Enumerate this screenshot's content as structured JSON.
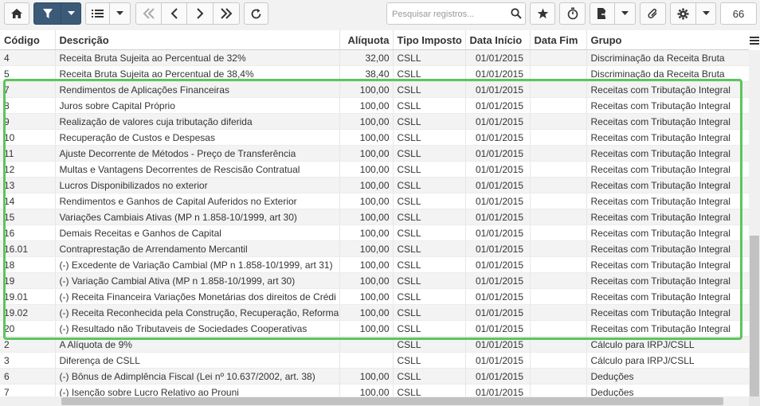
{
  "toolbar": {
    "search_placeholder": "Pesquisar registros...",
    "record_count": "66"
  },
  "colors": {
    "filter_button": "#3a5a78",
    "highlight": "#5cc55c"
  },
  "icons": [
    "home-icon",
    "filter-icon",
    "chevron-down-icon",
    "list-icon",
    "first-page-icon",
    "prev-page-icon",
    "next-page-icon",
    "last-page-icon",
    "refresh-icon",
    "search-icon",
    "star-icon",
    "stopwatch-icon",
    "export-icon",
    "paperclip-icon",
    "gear-icon",
    "menu-icon"
  ],
  "table": {
    "headers": {
      "codigo": "Código",
      "descricao": "Descrição",
      "aliquota": "Alíquota",
      "tipo": "Tipo Imposto",
      "inicio": "Data Início",
      "fim": "Data Fim",
      "grupo": "Grupo"
    },
    "rows": [
      {
        "codigo": "4",
        "descricao": "Receita Bruta Sujeita ao Percentual de 32%",
        "aliquota": "32,00",
        "tipo": "CSLL",
        "inicio": "01/01/2015",
        "fim": "",
        "grupo": "Discriminação da Receita Bruta"
      },
      {
        "codigo": "5",
        "descricao": "Receita Bruta Sujeita ao Percentual de 38,4%",
        "aliquota": "38,40",
        "tipo": "CSLL",
        "inicio": "01/01/2015",
        "fim": "",
        "grupo": "Discriminação da Receita Bruta"
      },
      {
        "codigo": "7",
        "descricao": "Rendimentos de Aplicações Financeiras",
        "aliquota": "100,00",
        "tipo": "CSLL",
        "inicio": "01/01/2015",
        "fim": "",
        "grupo": "Receitas com Tributação Integral"
      },
      {
        "codigo": "8",
        "descricao": "Juros sobre Capital Próprio",
        "aliquota": "100,00",
        "tipo": "CSLL",
        "inicio": "01/01/2015",
        "fim": "",
        "grupo": "Receitas com Tributação Integral"
      },
      {
        "codigo": "9",
        "descricao": "Realização de valores cuja tributação diferida",
        "aliquota": "100,00",
        "tipo": "CSLL",
        "inicio": "01/01/2015",
        "fim": "",
        "grupo": "Receitas com Tributação Integral"
      },
      {
        "codigo": "10",
        "descricao": "Recuperação de Custos e Despesas",
        "aliquota": "100,00",
        "tipo": "CSLL",
        "inicio": "01/01/2015",
        "fim": "",
        "grupo": "Receitas com Tributação Integral"
      },
      {
        "codigo": "11",
        "descricao": "Ajuste Decorrente de Métodos - Preço de Transferência",
        "aliquota": "100,00",
        "tipo": "CSLL",
        "inicio": "01/01/2015",
        "fim": "",
        "grupo": "Receitas com Tributação Integral"
      },
      {
        "codigo": "12",
        "descricao": "Multas e Vantagens Decorrentes de Rescisão Contratual",
        "aliquota": "100,00",
        "tipo": "CSLL",
        "inicio": "01/01/2015",
        "fim": "",
        "grupo": "Receitas com Tributação Integral"
      },
      {
        "codigo": "13",
        "descricao": "Lucros Disponibilizados no exterior",
        "aliquota": "100,00",
        "tipo": "CSLL",
        "inicio": "01/01/2015",
        "fim": "",
        "grupo": "Receitas com Tributação Integral"
      },
      {
        "codigo": "14",
        "descricao": "Rendimentos e Ganhos de Capital Auferidos no Exterior",
        "aliquota": "100,00",
        "tipo": "CSLL",
        "inicio": "01/01/2015",
        "fim": "",
        "grupo": "Receitas com Tributação Integral"
      },
      {
        "codigo": "15",
        "descricao": "Variações Cambiais Ativas (MP n 1.858-10/1999, art 30)",
        "aliquota": "100,00",
        "tipo": "CSLL",
        "inicio": "01/01/2015",
        "fim": "",
        "grupo": "Receitas com Tributação Integral"
      },
      {
        "codigo": "16",
        "descricao": "Demais Receitas e Ganhos de Capital",
        "aliquota": "100,00",
        "tipo": "CSLL",
        "inicio": "01/01/2015",
        "fim": "",
        "grupo": "Receitas com Tributação Integral"
      },
      {
        "codigo": "16.01",
        "descricao": "Contraprestação de Arrendamento Mercantil",
        "aliquota": "100,00",
        "tipo": "CSLL",
        "inicio": "01/01/2015",
        "fim": "",
        "grupo": "Receitas com Tributação Integral"
      },
      {
        "codigo": "18",
        "descricao": "(-) Excedente de Variação Cambial (MP n 1.858-10/1999, art 31)",
        "aliquota": "100,00",
        "tipo": "CSLL",
        "inicio": "01/01/2015",
        "fim": "",
        "grupo": "Receitas com Tributação Integral"
      },
      {
        "codigo": "19",
        "descricao": "(-) Variação Cambial Ativa (MP n 1.858-10/1999, art 30)",
        "aliquota": "100,00",
        "tipo": "CSLL",
        "inicio": "01/01/2015",
        "fim": "",
        "grupo": "Receitas com Tributação Integral"
      },
      {
        "codigo": "19.01",
        "descricao": "(-) Receita Financeira Variações Monetárias dos direitos de Crédi",
        "aliquota": "100,00",
        "tipo": "CSLL",
        "inicio": "01/01/2015",
        "fim": "",
        "grupo": "Receitas com Tributação Integral"
      },
      {
        "codigo": "19.02",
        "descricao": "(-) Receita Reconhecida pela Construção, Recuperação, Reforma",
        "aliquota": "100,00",
        "tipo": "CSLL",
        "inicio": "01/01/2015",
        "fim": "",
        "grupo": "Receitas com Tributação Integral"
      },
      {
        "codigo": "20",
        "descricao": "(-) Resultado não Tributaveis de Sociedades Cooperativas",
        "aliquota": "100,00",
        "tipo": "CSLL",
        "inicio": "01/01/2015",
        "fim": "",
        "grupo": "Receitas com Tributação Integral"
      },
      {
        "codigo": "2",
        "descricao": "A Alíquota de 9%",
        "aliquota": "",
        "tipo": "CSLL",
        "inicio": "01/01/2015",
        "fim": "",
        "grupo": "Cálculo para IRPJ/CSLL"
      },
      {
        "codigo": "3",
        "descricao": "Diferença de CSLL",
        "aliquota": "",
        "tipo": "CSLL",
        "inicio": "01/01/2015",
        "fim": "",
        "grupo": "Cálculo para IRPJ/CSLL"
      },
      {
        "codigo": "6",
        "descricao": "(-) Bônus de Adimplência Fiscal (Lei nº 10.637/2002, art. 38)",
        "aliquota": "100,00",
        "tipo": "CSLL",
        "inicio": "01/01/2015",
        "fim": "",
        "grupo": "Deduções"
      },
      {
        "codigo": "7",
        "descricao": "(-) Isenção sobre Lucro Relativo ao Prouni",
        "aliquota": "100,00",
        "tipo": "CSLL",
        "inicio": "01/01/2015",
        "fim": "",
        "grupo": "Deduções"
      }
    ]
  }
}
